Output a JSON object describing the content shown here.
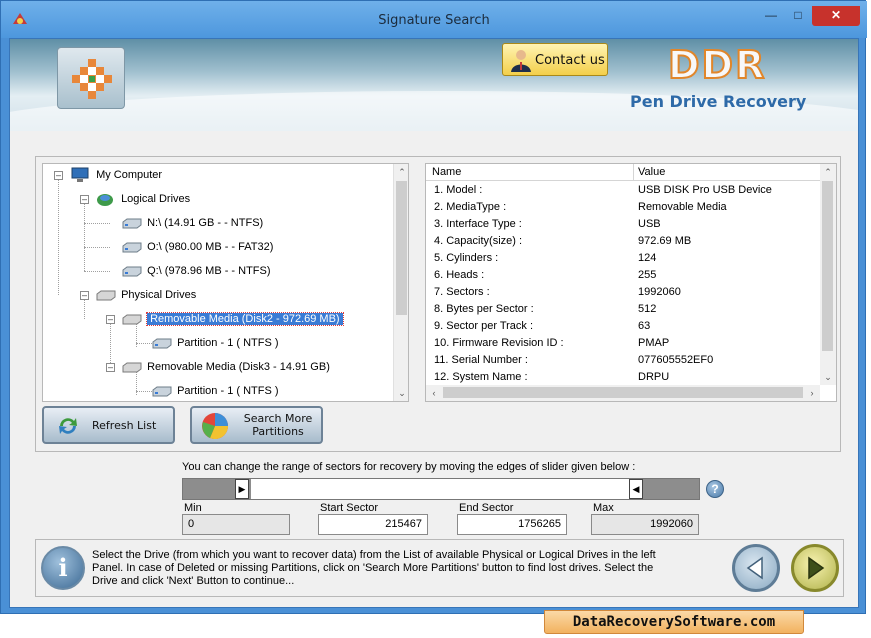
{
  "window": {
    "title": "Signature Search"
  },
  "header": {
    "contact_label": "Contact us",
    "brand": "DDR",
    "tagline": "Pen Drive Recovery"
  },
  "tree": {
    "root": "My Computer",
    "logical_group": "Logical Drives",
    "logical_drives": [
      "N:\\ (14.91 GB -  - NTFS)",
      "O:\\ (980.00 MB -  - FAT32)",
      "Q:\\ (978.96 MB -  - NTFS)"
    ],
    "physical_group": "Physical Drives",
    "disk2": "Removable Media (Disk2 - 972.69 MB)",
    "disk2_partition": "Partition - 1 ( NTFS )",
    "disk3": "Removable Media (Disk3 - 14.91 GB)",
    "disk3_partition": "Partition - 1 ( NTFS )"
  },
  "properties": {
    "col_name": "Name",
    "col_value": "Value",
    "rows": [
      {
        "name": "1. Model :",
        "value": "USB DISK Pro USB Device"
      },
      {
        "name": "2. MediaType :",
        "value": "Removable Media"
      },
      {
        "name": "3. Interface Type :",
        "value": "USB"
      },
      {
        "name": "4. Capacity(size) :",
        "value": "972.69 MB"
      },
      {
        "name": "5. Cylinders :",
        "value": "124"
      },
      {
        "name": "6. Heads :",
        "value": "255"
      },
      {
        "name": "7. Sectors :",
        "value": "1992060"
      },
      {
        "name": "8. Bytes per Sector :",
        "value": "512"
      },
      {
        "name": "9. Sector per Track :",
        "value": "63"
      },
      {
        "name": "10. Firmware Revision ID :",
        "value": "PMAP"
      },
      {
        "name": "11. Serial Number :",
        "value": "077605552EF0"
      },
      {
        "name": "12. System Name :",
        "value": "DRPU"
      }
    ]
  },
  "buttons": {
    "refresh": "Refresh List",
    "search_line1": "Search More",
    "search_line2": "Partitions"
  },
  "slider": {
    "caption": "You can change the range of sectors for recovery by moving the edges of slider given below :",
    "min_label": "Min",
    "min_value": "0",
    "start_label": "Start Sector",
    "start_value": "215467",
    "end_label": "End Sector",
    "end_value": "1756265",
    "max_label": "Max",
    "max_value": "1992060"
  },
  "info": {
    "text": "Select the Drive (from which you want to recover data) from the List of available Physical or Logical Drives in the left Panel. In case of Deleted or missing Partitions, click on 'Search More Partitions' button to find lost drives. Select the Drive and click 'Next' Button to continue..."
  },
  "footer": {
    "site": "DataRecoverySoftware.com"
  }
}
